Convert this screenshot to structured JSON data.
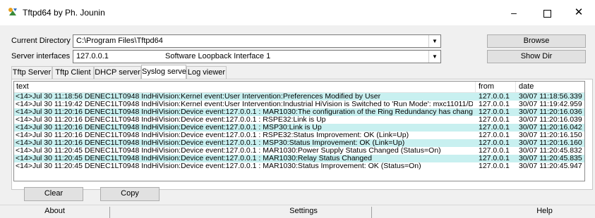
{
  "window": {
    "title": "Tftpd64 by Ph. Jounin",
    "minimize": "–",
    "close": "✕"
  },
  "settings_row": {
    "current_directory_label": "Current Directory",
    "current_directory_value": "C:\\Program Files\\Tftpd64",
    "browse_button_label": "Browse",
    "server_interfaces_label": "Server interfaces",
    "server_interface_ip": "127.0.0.1",
    "server_interface_name": "Software Loopback Interface 1",
    "show_dir_button_label": "Show Dir"
  },
  "tabs": [
    {
      "label": "Tftp Server",
      "active": false
    },
    {
      "label": "Tftp Client",
      "active": false
    },
    {
      "label": "DHCP server",
      "active": false
    },
    {
      "label": "Syslog server",
      "active": true
    },
    {
      "label": "Log viewer",
      "active": false
    }
  ],
  "syslog": {
    "columns": [
      "text",
      "from",
      "date"
    ],
    "rows": [
      {
        "text": "<14>Jul 30 11:18:56 DENEC1LT0948 IndHiVision:Kernel event:User Intervention:Preferences Modified by User",
        "from": "127.0.0.1",
        "date": "30/07 11:18:56.339"
      },
      {
        "text": "<14>Jul 30 11:19:42 DENEC1LT0948 IndHiVision:Kernel event:User Intervention:Industrial HiVision is Switched to 'Run Mode': mxc11011/DEN...",
        "from": "127.0.0.1",
        "date": "30/07 11:19:42.959"
      },
      {
        "text": "<14>Jul 30 11:20:16 DENEC1LT0948 IndHiVision:Device event:127.0.0.1 : MAR1030:The configuration of the Ring Redundancy has changed",
        "from": "127.0.0.1",
        "date": "30/07 11:20:16.036"
      },
      {
        "text": "<14>Jul 30 11:20:16 DENEC1LT0948 IndHiVision:Device event:127.0.0.1 : RSPE32:Link is Up",
        "from": "127.0.0.1",
        "date": "30/07 11:20:16.039"
      },
      {
        "text": "<14>Jul 30 11:20:16 DENEC1LT0948 IndHiVision:Device event:127.0.0.1 : MSP30:Link is Up",
        "from": "127.0.0.1",
        "date": "30/07 11:20:16.042"
      },
      {
        "text": "<14>Jul 30 11:20:16 DENEC1LT0948 IndHiVision:Device event:127.0.0.1 : RSPE32:Status Improvement: OK (Link=Up)",
        "from": "127.0.0.1",
        "date": "30/07 11:20:16.150"
      },
      {
        "text": "<14>Jul 30 11:20:16 DENEC1LT0948 IndHiVision:Device event:127.0.0.1 : MSP30:Status Improvement: OK (Link=Up)",
        "from": "127.0.0.1",
        "date": "30/07 11:20:16.160"
      },
      {
        "text": "<14>Jul 30 11:20:45 DENEC1LT0948 IndHiVision:Device event:127.0.0.1 : MAR1030:Power Supply Status Changed (Status=On)",
        "from": "127.0.0.1",
        "date": "30/07 11:20:45.832"
      },
      {
        "text": "<14>Jul 30 11:20:45 DENEC1LT0948 IndHiVision:Device event:127.0.0.1 : MAR1030:Relay Status Changed",
        "from": "127.0.0.1",
        "date": "30/07 11:20:45.835"
      },
      {
        "text": "<14>Jul 30 11:20:45 DENEC1LT0948 IndHiVision:Device event:127.0.0.1 : MAR1030:Status Improvement: OK (Status=On)",
        "from": "127.0.0.1",
        "date": "30/07 11:20:45.947"
      }
    ],
    "clear_button_label": "Clear",
    "copy_button_label": "Copy"
  },
  "bottom": {
    "about_label": "About",
    "settings_label": "Settings",
    "help_label": "Help"
  },
  "colors": {
    "row_highlight": "#c8f0f0"
  }
}
